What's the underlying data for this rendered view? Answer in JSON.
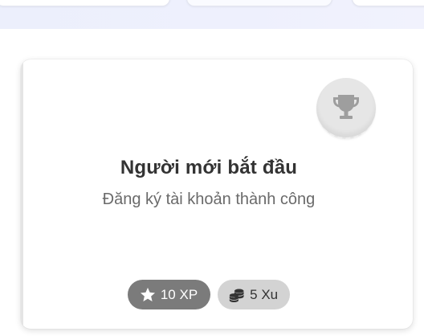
{
  "achievement": {
    "title": "Người mới bắt đầu",
    "description": "Đăng ký tài khoản thành công",
    "icon": "trophy-icon",
    "status": "locked",
    "rewards": {
      "xp_label": "10 XP",
      "xp_icon": "star-icon",
      "coin_label": "5 Xu",
      "coin_icon": "coins-icon"
    }
  },
  "colors": {
    "badge_bg": "#e6e6e6",
    "trophy": "#9e9e9e",
    "xp_pill": "#7b7b7b",
    "coin_pill": "#d3d3d3",
    "title": "#333333",
    "description": "#6a6a6a"
  }
}
